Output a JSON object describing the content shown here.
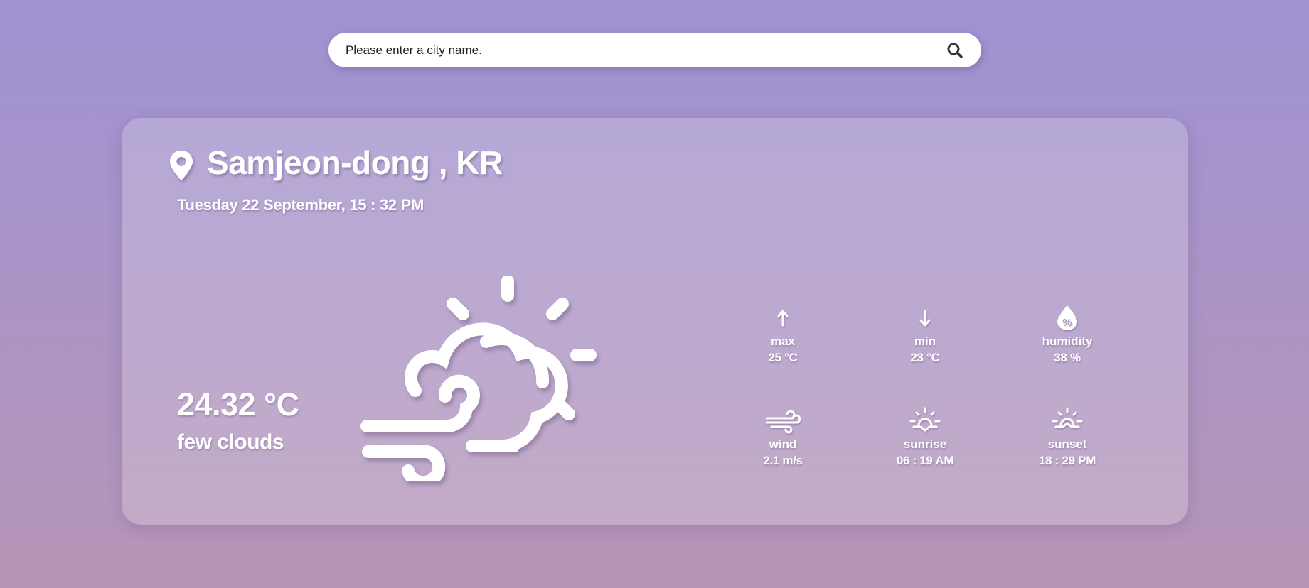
{
  "search": {
    "placeholder": "Please enter a city name.",
    "icon": "search-icon"
  },
  "weather": {
    "location": "Samjeon-dong , KR",
    "datetime": "Tuesday 22 September, 15 : 32 PM",
    "temperature": "24.32 °C",
    "description": "few clouds",
    "condition_icon": "partly-cloudy-windy-icon"
  },
  "stats": {
    "max": {
      "label": "max",
      "value": "25 °C",
      "icon": "arrow-up-icon"
    },
    "min": {
      "label": "min",
      "value": "23 °C",
      "icon": "arrow-down-icon"
    },
    "humidity": {
      "label": "humidity",
      "value": "38 %",
      "icon": "humidity-drop-icon"
    },
    "wind": {
      "label": "wind",
      "value": "2.1 m/s",
      "icon": "wind-icon"
    },
    "sunrise": {
      "label": "sunrise",
      "value": "06 : 19 AM",
      "icon": "sunrise-icon"
    },
    "sunset": {
      "label": "sunset",
      "value": "18 : 29 PM",
      "icon": "sunset-icon"
    }
  },
  "colors": {
    "background_top": "#9f92d2",
    "background_bottom": "#b795b6",
    "card": "rgba(255,255,255,0.20)",
    "text": "#ffffff"
  }
}
